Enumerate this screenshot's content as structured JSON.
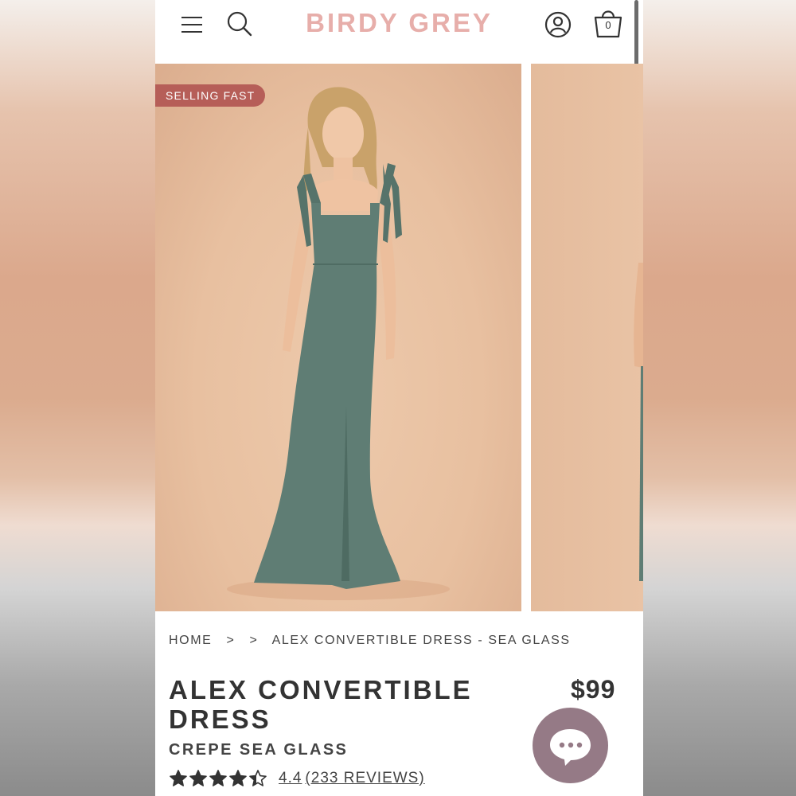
{
  "header": {
    "logo": "BIRDY GREY",
    "cart_count": "0",
    "icons": [
      "menu-icon",
      "search-icon",
      "account-icon",
      "shopping-bag-icon"
    ]
  },
  "gallery": {
    "badge": "SELLING FAST",
    "dress_color": "#5f7d74",
    "background_color": "#e8c0a0"
  },
  "breadcrumb": {
    "home": "HOME",
    "separator1": ">",
    "separator2": ">",
    "current": "ALEX CONVERTIBLE DRESS - SEA GLASS"
  },
  "product": {
    "title": "ALEX CONVERTIBLE DRESS",
    "price": "$99",
    "subtitle": "CREPE SEA GLASS",
    "rating_value": "4.4",
    "reviews": "(233 REVIEWS)",
    "stars_max": 5
  },
  "chat": {
    "icon": "chat-bubble-icon"
  },
  "colors": {
    "logo": "#e7aeaa",
    "badge": "#b65e58",
    "chat": "#957a86",
    "text": "#333333"
  }
}
